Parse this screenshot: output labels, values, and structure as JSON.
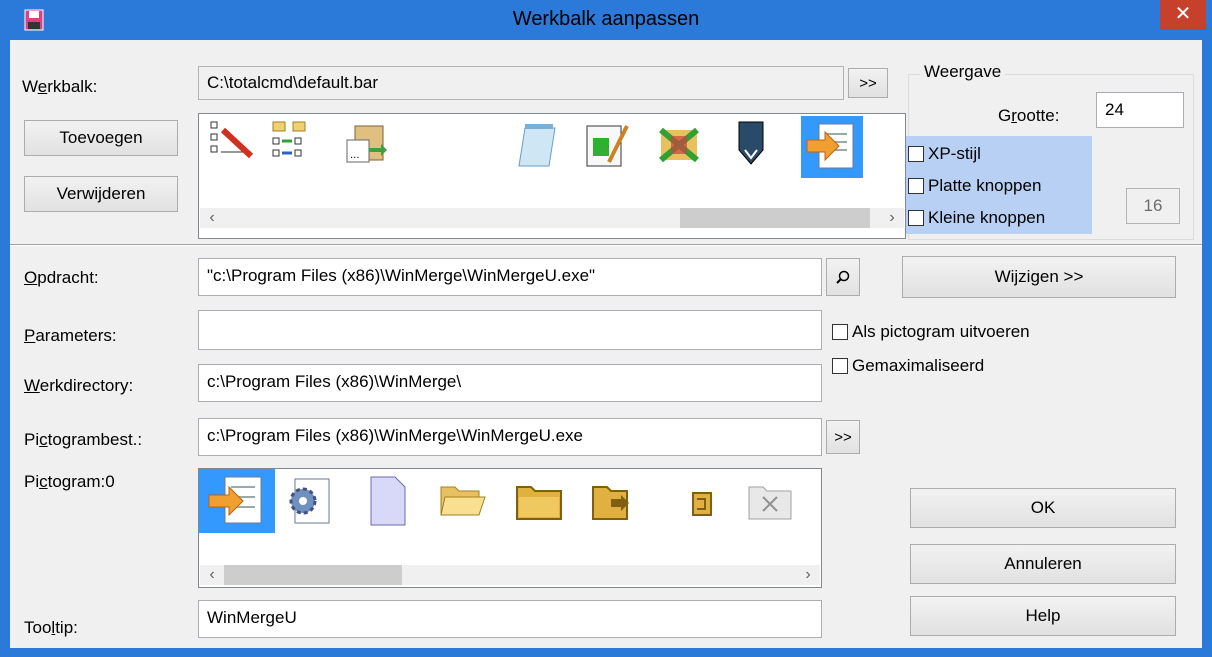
{
  "window": {
    "title": "Werkbalk aanpassen",
    "close_glyph": "✕"
  },
  "toolbar_section": {
    "label": "Werkbalk:",
    "path": "C:\\totalcmd\\default.bar",
    "browse_label": ">>",
    "add_button": "Toevoegen",
    "remove_button": "Verwijderen",
    "icons": [
      "tree-edit-icon",
      "compare-dirs-icon",
      "paste-path-icon",
      "blank",
      "notepad-icon",
      "text-editor-icon",
      "winmerge-x-icon",
      "pen-icon",
      "winmerge-icon"
    ]
  },
  "view_group": {
    "title": "Weergave",
    "size_label": "Grootte:",
    "size_value": "24",
    "xp_style": "XP-stijl",
    "flat_buttons": "Platte knoppen",
    "small_buttons": "Kleine knoppen",
    "small_size_value": "16"
  },
  "command": {
    "label": "Opdracht:",
    "value": "\"c:\\Program Files (x86)\\WinMerge\\WinMergeU.exe\"",
    "change_button": "Wijzigen >>"
  },
  "parameters": {
    "label": "Parameters:",
    "value": ""
  },
  "options": {
    "run_minimized": "Als pictogram uitvoeren",
    "maximized": "Gemaximaliseerd"
  },
  "workdir": {
    "label": "Werkdirectory:",
    "value": "c:\\Program Files (x86)\\WinMerge\\"
  },
  "iconfile": {
    "label": "Pictogrambest.:",
    "value": "c:\\Program Files (x86)\\WinMerge\\WinMergeU.exe",
    "browse_label": ">>"
  },
  "icon_picker": {
    "label": "Pictogram:0",
    "icons": [
      "winmerge-icon",
      "project-icon",
      "document-icon",
      "open-folder-icon",
      "folder-icon",
      "folder-arrow-icon",
      "file-small-icon",
      "folder-x-icon"
    ]
  },
  "tooltip": {
    "label": "Tooltip:",
    "value": "WinMergeU"
  },
  "dialog_buttons": {
    "ok": "OK",
    "cancel": "Annuleren",
    "help": "Help"
  },
  "colors": {
    "titlebar": "#2b79d8",
    "close": "#c7402c",
    "selection": "#3399ff",
    "highlight": "#b8d0f4"
  }
}
